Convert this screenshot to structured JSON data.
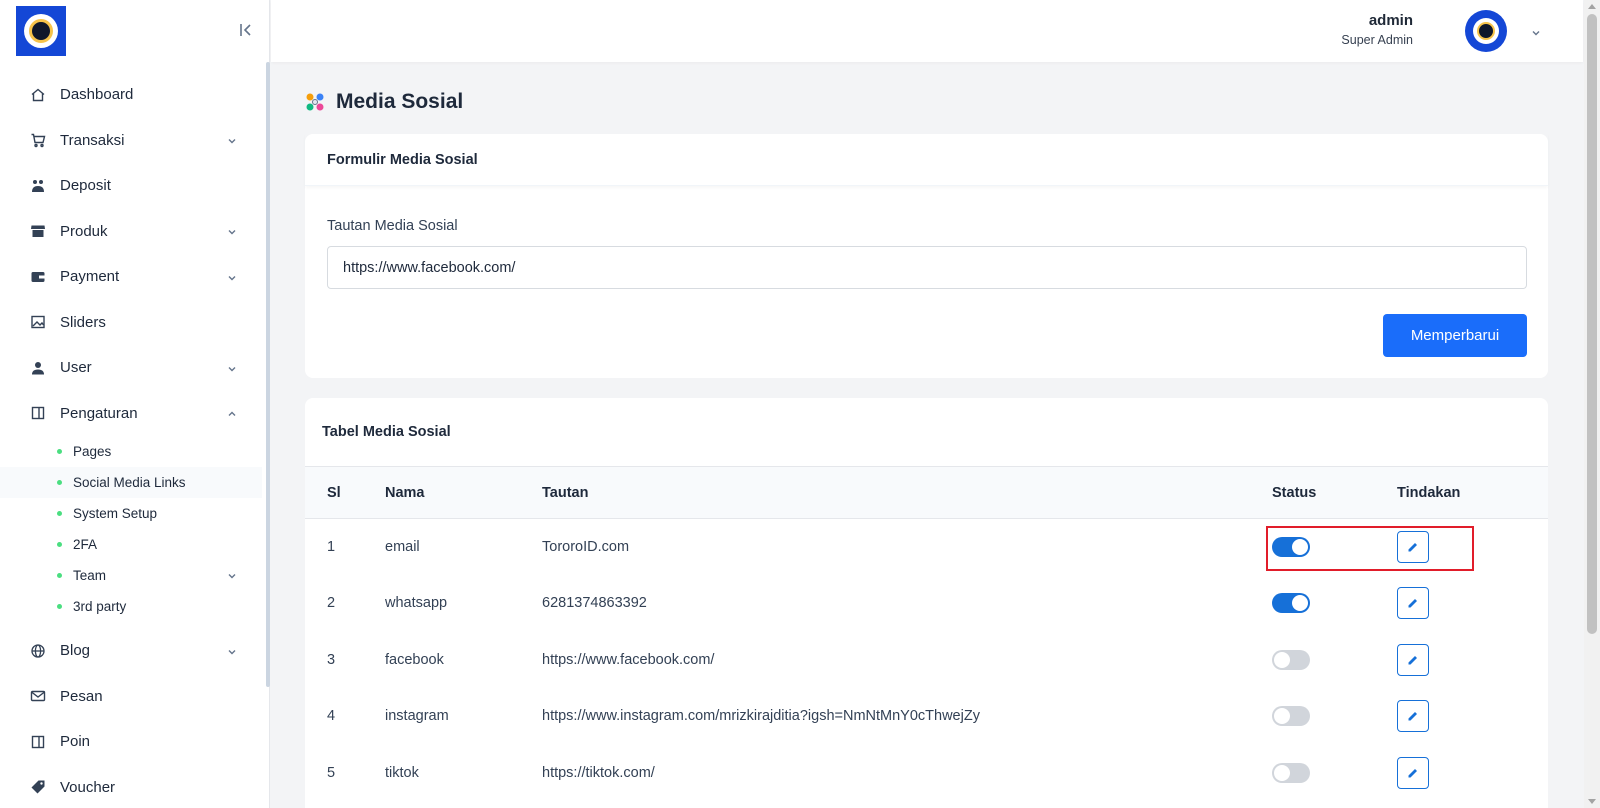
{
  "sidebar": {
    "logo_icon": "app-logo",
    "collapse_icon": "collapse-left-icon",
    "items": [
      {
        "label": "Dashboard",
        "icon": "home-icon",
        "has_children": false
      },
      {
        "label": "Transaksi",
        "icon": "cart-icon",
        "has_children": true
      },
      {
        "label": "Deposit",
        "icon": "deposit-icon",
        "has_children": false
      },
      {
        "label": "Produk",
        "icon": "store-icon",
        "has_children": true
      },
      {
        "label": "Payment",
        "icon": "wallet-icon",
        "has_children": true
      },
      {
        "label": "Sliders",
        "icon": "image-icon",
        "has_children": false
      },
      {
        "label": "User",
        "icon": "user-icon",
        "has_children": true
      },
      {
        "label": "Pengaturan",
        "icon": "settings-panel-icon",
        "has_children": true,
        "expanded": true
      },
      {
        "label": "Blog",
        "icon": "globe-icon",
        "has_children": true
      },
      {
        "label": "Pesan",
        "icon": "mail-icon",
        "has_children": false
      },
      {
        "label": "Poin",
        "icon": "points-icon",
        "has_children": false
      },
      {
        "label": "Voucher",
        "icon": "tag-icon",
        "has_children": false
      }
    ],
    "pengaturan_sub": [
      {
        "label": "Pages"
      },
      {
        "label": "Social Media Links",
        "active": true
      },
      {
        "label": "System Setup"
      },
      {
        "label": "2FA"
      },
      {
        "label": "Team",
        "has_children": true
      },
      {
        "label": "3rd party"
      }
    ]
  },
  "header": {
    "user_name": "admin",
    "user_role": "Super Admin"
  },
  "page": {
    "title": "Media Sosial"
  },
  "form": {
    "title": "Formulir Media Sosial",
    "field_label": "Tautan Media Sosial",
    "field_value": "https://www.facebook.com/",
    "submit_label": "Memperbarui"
  },
  "table": {
    "title": "Tabel Media Sosial",
    "headers": {
      "sl": "Sl",
      "nama": "Nama",
      "tautan": "Tautan",
      "status": "Status",
      "tindakan": "Tindakan"
    },
    "rows": [
      {
        "sl": "1",
        "nama": "email",
        "tautan": "TororoID.com",
        "status": true
      },
      {
        "sl": "2",
        "nama": "whatsapp",
        "tautan": "6281374863392",
        "status": true
      },
      {
        "sl": "3",
        "nama": "facebook",
        "tautan": "https://www.facebook.com/",
        "status": false
      },
      {
        "sl": "4",
        "nama": "instagram",
        "tautan": "https://www.instagram.com/mrizkirajditia?igsh=NmNtMnY0cThwejZy",
        "status": false
      },
      {
        "sl": "5",
        "nama": "tiktok",
        "tautan": "https://tiktok.com/",
        "status": false
      }
    ]
  },
  "colors": {
    "primary": "#1a6dfa",
    "toggle_on": "#1670d8",
    "highlight": "#e11d2a",
    "logo_bg": "#1447d6"
  }
}
